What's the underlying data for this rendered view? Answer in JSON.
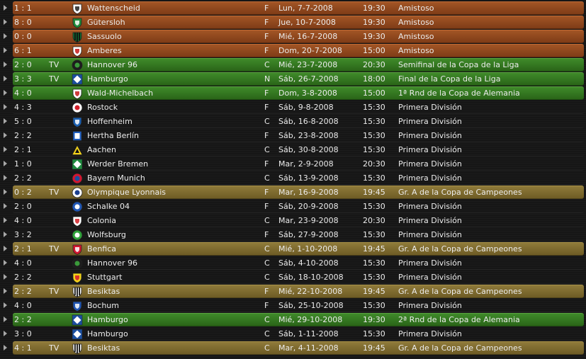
{
  "fixtures": [
    {
      "score": "1 : 1",
      "tv": "",
      "team": "Wattenscheid",
      "venue": "F",
      "date": "Lun, 7-7-2008",
      "time": "19:30",
      "competition": "Amistoso",
      "style": "amistoso",
      "crest": {
        "shape": "shield",
        "fill": "#ffffff",
        "mark": "#222222",
        "icon": "club-crest-icon"
      }
    },
    {
      "score": "8 : 0",
      "tv": "",
      "team": "Gütersloh",
      "venue": "F",
      "date": "Jue, 10-7-2008",
      "time": "19:30",
      "competition": "Amistoso",
      "style": "amistoso",
      "crest": {
        "shape": "shield",
        "fill": "#1f8a3a",
        "mark": "#ffffff",
        "icon": "club-crest-icon"
      }
    },
    {
      "score": "0 : 0",
      "tv": "",
      "team": "Sassuolo",
      "venue": "F",
      "date": "Mié, 16-7-2008",
      "time": "19:30",
      "competition": "Amistoso",
      "style": "amistoso",
      "crest": {
        "shape": "stripes",
        "fill": "#0f6b2f",
        "mark": "#111111",
        "icon": "club-crest-icon"
      }
    },
    {
      "score": "6 : 1",
      "tv": "",
      "team": "Amberes",
      "venue": "F",
      "date": "Dom, 20-7-2008",
      "time": "15:00",
      "competition": "Amistoso",
      "style": "amistoso",
      "crest": {
        "shape": "shield",
        "fill": "#ffffff",
        "mark": "#c41a1a",
        "icon": "club-crest-icon"
      }
    },
    {
      "score": "2 : 0",
      "tv": "TV",
      "team": "Hannover 96",
      "venue": "C",
      "date": "Mié, 23-7-2008",
      "time": "20:30",
      "competition": "Semifinal de la Copa de la Liga",
      "style": "green",
      "crest": {
        "shape": "circle",
        "fill": "#1d1d1d",
        "mark": "#3a9a3a",
        "icon": "club-crest-icon"
      }
    },
    {
      "score": "3 : 3",
      "tv": "TV",
      "team": "Hamburgo",
      "venue": "N",
      "date": "Sáb, 26-7-2008",
      "time": "18:00",
      "competition": "Final de la Copa de la Liga",
      "style": "green",
      "crest": {
        "shape": "diamond",
        "fill": "#1b4fa0",
        "mark": "#ffffff",
        "icon": "club-crest-icon"
      }
    },
    {
      "score": "4 : 0",
      "tv": "",
      "team": "Wald-Michelbach",
      "venue": "F",
      "date": "Dom, 3-8-2008",
      "time": "15:00",
      "competition": "1ª Rnd de la Copa de Alemania",
      "style": "green",
      "crest": {
        "shape": "shield",
        "fill": "#ffffff",
        "mark": "#c41a1a",
        "icon": "club-crest-icon"
      }
    },
    {
      "score": "4 : 3",
      "tv": "",
      "team": "Rostock",
      "venue": "F",
      "date": "Sáb, 9-8-2008",
      "time": "15:30",
      "competition": "Primera División",
      "style": "plain",
      "crest": {
        "shape": "circle",
        "fill": "#ffffff",
        "mark": "#d21f2a",
        "icon": "club-crest-icon"
      }
    },
    {
      "score": "5 : 0",
      "tv": "",
      "team": "Hoffenheim",
      "venue": "C",
      "date": "Sáb, 16-8-2008",
      "time": "15:30",
      "competition": "Primera División",
      "style": "plain",
      "crest": {
        "shape": "shield",
        "fill": "#1b5fb0",
        "mark": "#ffffff",
        "icon": "club-crest-icon"
      }
    },
    {
      "score": "2 : 2",
      "tv": "",
      "team": "Hertha Berlín",
      "venue": "F",
      "date": "Sáb, 23-8-2008",
      "time": "15:30",
      "competition": "Primera División",
      "style": "plain",
      "crest": {
        "shape": "rect",
        "fill": "#1f5fbf",
        "mark": "#ffffff",
        "icon": "club-crest-icon"
      }
    },
    {
      "score": "2 : 1",
      "tv": "",
      "team": "Aachen",
      "venue": "C",
      "date": "Sáb, 30-8-2008",
      "time": "15:30",
      "competition": "Primera División",
      "style": "plain",
      "crest": {
        "shape": "triangle",
        "fill": "#f2d21a",
        "mark": "#111111",
        "icon": "club-crest-icon"
      }
    },
    {
      "score": "1 : 0",
      "tv": "",
      "team": "Werder Bremen",
      "venue": "F",
      "date": "Mar, 2-9-2008",
      "time": "20:30",
      "competition": "Primera División",
      "style": "plain",
      "crest": {
        "shape": "diamond",
        "fill": "#1e8a3e",
        "mark": "#ffffff",
        "icon": "club-crest-icon"
      }
    },
    {
      "score": "2 : 2",
      "tv": "",
      "team": "Bayern Munich",
      "venue": "C",
      "date": "Sáb, 13-9-2008",
      "time": "15:30",
      "competition": "Primera División",
      "style": "plain",
      "crest": {
        "shape": "circle",
        "fill": "#d3162f",
        "mark": "#1b4fa0",
        "icon": "club-crest-icon"
      }
    },
    {
      "score": "0 : 2",
      "tv": "TV",
      "team": "Olympique Lyonnais",
      "venue": "F",
      "date": "Mar, 16-9-2008",
      "time": "19:45",
      "competition": "Gr. A de la Copa de Campeones",
      "style": "gold",
      "crest": {
        "shape": "circle",
        "fill": "#ffffff",
        "mark": "#1b3f8f",
        "icon": "club-crest-icon"
      }
    },
    {
      "score": "2 : 0",
      "tv": "",
      "team": "Schalke 04",
      "venue": "F",
      "date": "Sáb, 20-9-2008",
      "time": "15:30",
      "competition": "Primera División",
      "style": "plain",
      "crest": {
        "shape": "circle",
        "fill": "#1f56b4",
        "mark": "#ffffff",
        "icon": "club-crest-icon"
      }
    },
    {
      "score": "4 : 0",
      "tv": "",
      "team": "Colonia",
      "venue": "C",
      "date": "Mar, 23-9-2008",
      "time": "20:30",
      "competition": "Primera División",
      "style": "plain",
      "crest": {
        "shape": "shield",
        "fill": "#ffffff",
        "mark": "#d11f26",
        "icon": "club-crest-icon"
      }
    },
    {
      "score": "3 : 2",
      "tv": "",
      "team": "Wolfsburg",
      "venue": "F",
      "date": "Sáb, 27-9-2008",
      "time": "15:30",
      "competition": "Primera División",
      "style": "plain",
      "crest": {
        "shape": "circle",
        "fill": "#2fa33a",
        "mark": "#ffffff",
        "icon": "club-crest-icon"
      }
    },
    {
      "score": "2 : 1",
      "tv": "TV",
      "team": "Benfica",
      "venue": "C",
      "date": "Mié, 1-10-2008",
      "time": "19:45",
      "competition": "Gr. A de la Copa de Campeones",
      "style": "gold",
      "crest": {
        "shape": "shield",
        "fill": "#d3162f",
        "mark": "#ffffff",
        "icon": "club-crest-icon"
      }
    },
    {
      "score": "4 : 0",
      "tv": "",
      "team": "Hannover 96",
      "venue": "C",
      "date": "Sáb, 4-10-2008",
      "time": "15:30",
      "competition": "Primera División",
      "style": "plain",
      "crest": {
        "shape": "circle",
        "fill": "#1d1d1d",
        "mark": "#3a9a3a",
        "icon": "club-crest-icon"
      }
    },
    {
      "score": "2 : 2",
      "tv": "",
      "team": "Stuttgart",
      "venue": "C",
      "date": "Sáb, 18-10-2008",
      "time": "15:30",
      "competition": "Primera División",
      "style": "plain",
      "crest": {
        "shape": "shield",
        "fill": "#f2d21a",
        "mark": "#d3162f",
        "icon": "club-crest-icon"
      }
    },
    {
      "score": "2 : 2",
      "tv": "TV",
      "team": "Besiktas",
      "venue": "F",
      "date": "Mié, 22-10-2008",
      "time": "19:45",
      "competition": "Gr. A de la Copa de Campeones",
      "style": "gold",
      "crest": {
        "shape": "stripes",
        "fill": "#ffffff",
        "mark": "#111111",
        "icon": "club-crest-icon"
      }
    },
    {
      "score": "4 : 0",
      "tv": "",
      "team": "Bochum",
      "venue": "F",
      "date": "Sáb, 25-10-2008",
      "time": "15:30",
      "competition": "Primera División",
      "style": "plain",
      "crest": {
        "shape": "shield",
        "fill": "#1f56b4",
        "mark": "#ffffff",
        "icon": "club-crest-icon"
      }
    },
    {
      "score": "2 : 2",
      "tv": "",
      "team": "Hamburgo",
      "venue": "C",
      "date": "Mié, 29-10-2008",
      "time": "19:30",
      "competition": "2ª Rnd de la Copa de Alemania",
      "style": "green",
      "crest": {
        "shape": "diamond",
        "fill": "#1b4fa0",
        "mark": "#ffffff",
        "icon": "club-crest-icon"
      }
    },
    {
      "score": "3 : 0",
      "tv": "",
      "team": "Hamburgo",
      "venue": "C",
      "date": "Sáb, 1-11-2008",
      "time": "15:30",
      "competition": "Primera División",
      "style": "plain",
      "crest": {
        "shape": "diamond",
        "fill": "#1b4fa0",
        "mark": "#ffffff",
        "icon": "club-crest-icon"
      }
    },
    {
      "score": "4 : 1",
      "tv": "TV",
      "team": "Besiktas",
      "venue": "C",
      "date": "Mar, 4-11-2008",
      "time": "19:45",
      "competition": "Gr. A de la Copa de Campeones",
      "style": "gold",
      "crest": {
        "shape": "stripes",
        "fill": "#ffffff",
        "mark": "#111111",
        "icon": "club-crest-icon"
      }
    }
  ]
}
